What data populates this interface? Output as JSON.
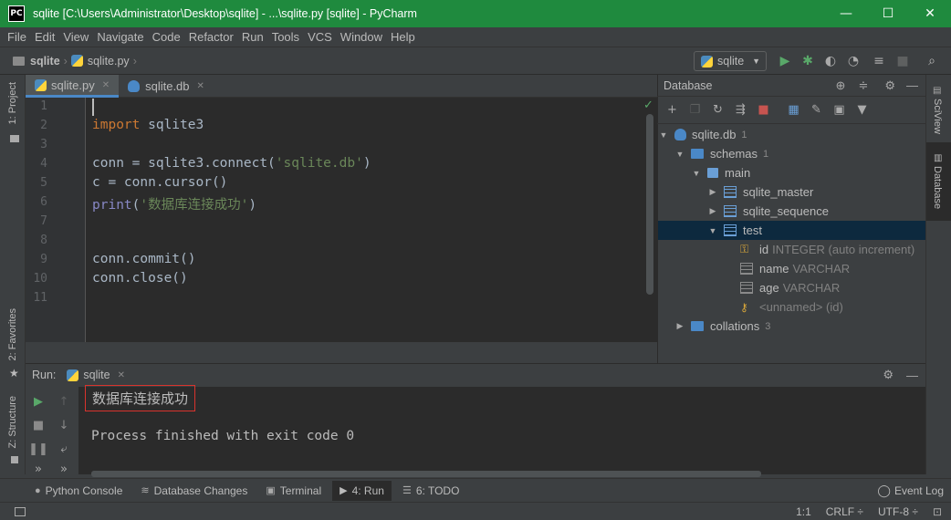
{
  "window": {
    "app_badge": "PC",
    "title": "sqlite [C:\\Users\\Administrator\\Desktop\\sqlite] - ...\\sqlite.py [sqlite] - PyCharm",
    "minimize": "—",
    "maximize": "☐",
    "close": "✕"
  },
  "menu": [
    "File",
    "Edit",
    "View",
    "Navigate",
    "Code",
    "Refactor",
    "Run",
    "Tools",
    "VCS",
    "Window",
    "Help"
  ],
  "navbar": {
    "project": "sqlite",
    "file": "sqlite.py",
    "run_config": "sqlite"
  },
  "left_stripe": {
    "project": "1: Project",
    "favorites": "2: Favorites",
    "structure": "Z: Structure"
  },
  "right_stripe": {
    "sciview": "SciView",
    "database": "Database"
  },
  "editor_tabs": [
    {
      "label": "sqlite.py",
      "active": true
    },
    {
      "label": "sqlite.db",
      "active": false
    }
  ],
  "code": {
    "line_numbers": [
      "1",
      "2",
      "3",
      "4",
      "5",
      "6",
      "7",
      "8",
      "9",
      "10",
      "11"
    ],
    "l2_kw": "import",
    "l2_rest": " sqlite3",
    "l4_a": "conn = sqlite3.connect(",
    "l4_str": "'sqlite.db'",
    "l4_b": ")",
    "l5": "c = conn.cursor()",
    "l6_fn": "print",
    "l6_a": "(",
    "l6_str": "'数据库连接成功'",
    "l6_b": ")",
    "l9": "conn.commit()",
    "l10": "conn.close()"
  },
  "database": {
    "title": "Database",
    "tree": {
      "root": {
        "label": "sqlite.db",
        "count": "1"
      },
      "schemas": {
        "label": "schemas",
        "count": "1"
      },
      "main": {
        "label": "main"
      },
      "tables": [
        "sqlite_master",
        "sqlite_sequence",
        "test"
      ],
      "columns": [
        {
          "name": "id",
          "type": "INTEGER (auto increment)"
        },
        {
          "name": "name",
          "type": "VARCHAR"
        },
        {
          "name": "age",
          "type": "VARCHAR"
        }
      ],
      "key": "<unnamed> (id)",
      "collations": {
        "label": "collations",
        "count": "3"
      }
    }
  },
  "run": {
    "label": "Run:",
    "tab": "sqlite",
    "output_line1": "数据库连接成功",
    "output_line2": "Process finished with exit code 0"
  },
  "bottom_tabs": {
    "python_console": "Python Console",
    "database_changes": "Database Changes",
    "terminal": "Terminal",
    "run": "4: Run",
    "todo": "6: TODO",
    "event_log": "Event Log"
  },
  "status": {
    "position": "1:1",
    "line_sep": "CRLF ÷",
    "encoding": "UTF-8 ÷"
  }
}
